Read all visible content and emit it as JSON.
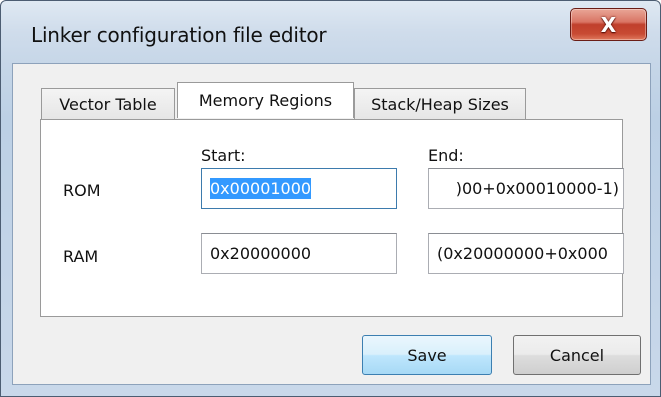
{
  "window": {
    "title": "Linker configuration file editor",
    "close_glyph": "X"
  },
  "tabs": [
    {
      "label": "Vector Table",
      "active": false
    },
    {
      "label": "Memory Regions",
      "active": true
    },
    {
      "label": "Stack/Heap Sizes",
      "active": false
    }
  ],
  "regions": {
    "start_header": "Start:",
    "end_header": "End:",
    "rows": [
      {
        "name": "ROM",
        "start": "0x00001000",
        "end": ")00+0x00010000-1)",
        "start_selected": true
      },
      {
        "name": "RAM",
        "start": "0x20000000",
        "end": "(0x20000000+0x000"
      }
    ]
  },
  "buttons": {
    "save": "Save",
    "cancel": "Cancel"
  },
  "colors": {
    "selection": "#3399ff",
    "close_button": "#c84a33",
    "default_button": "#bee6fd"
  }
}
